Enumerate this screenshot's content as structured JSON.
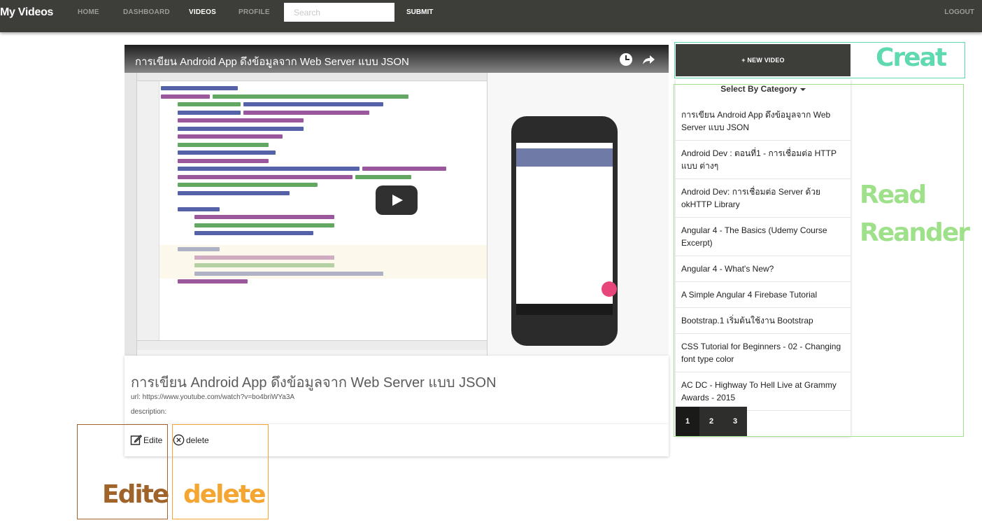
{
  "navbar": {
    "brand": "My Videos",
    "links": [
      "HOME",
      "DASHBOARD",
      "VIDEOS",
      "PROFILE"
    ],
    "active": "VIDEOS",
    "search_placeholder": "Search",
    "submit": "SUBMIT",
    "logout": "LOGOUT",
    "color": "#3d3d3a"
  },
  "player": {
    "title": "การเขียน Android App ดึงข้อมูลจาก Web Server แบบ JSON",
    "clock_icon": "watch-later-icon",
    "share_icon": "share-icon",
    "play_icon": "play-icon"
  },
  "video_info": {
    "title": "การเขียน Android App ดึงข้อมูลจาก Web Server แบบ JSON",
    "url": "url: https://www.youtube.com/watch?v=bo4briWYa3A",
    "description": "description:"
  },
  "actions": {
    "edit": "Edite",
    "delete": "delete"
  },
  "annotations": {
    "creat": {
      "label": "Creat",
      "color": "#5fd9b0"
    },
    "read": {
      "label": "Read\nReander",
      "color": "#9fe08a"
    },
    "edit": {
      "label": "Edite",
      "color": "#a0632a"
    },
    "delete": {
      "label": "delete",
      "color": "#f5a531"
    }
  },
  "sidebar": {
    "new_video": "+ NEW VIDEO",
    "category": "Select By Category",
    "videos": [
      "การเขียน Android App ดึงข้อมูลจาก Web Server แบบ JSON",
      "Android Dev : ตอนที่1 - การเชื่อมต่อ HTTP แบบ ต่างๆ",
      "Android Dev: การเชื่อมต่อ Server ด้วย okHTTP Library",
      "Angular 4 - The Basics (Udemy Course Excerpt)",
      "Angular 4 - What's New?",
      "A Simple Angular 4 Firebase Tutorial",
      "Bootstrap.1 เริ่มต้นใช้งาน Bootstrap",
      "CSS Tutorial for Beginners - 02 - Changing font type color",
      "AC DC - Highway To Hell Live at Grammy Awards - 2015"
    ],
    "pages": [
      "1",
      "2",
      "3"
    ],
    "active_page": "1"
  }
}
